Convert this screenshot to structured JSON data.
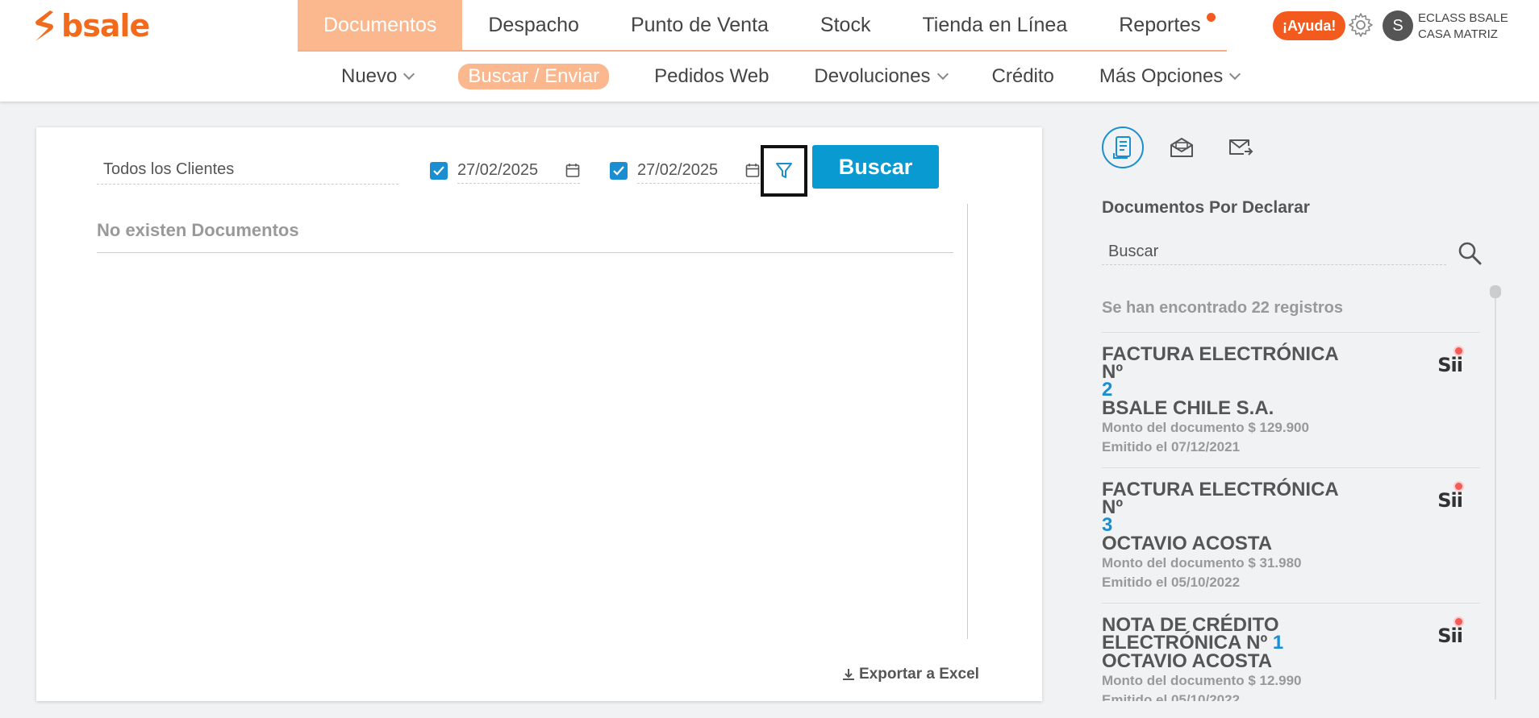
{
  "brand": {
    "name": "bsale",
    "color": "#f26b1d"
  },
  "main_nav": [
    {
      "label": "Documentos",
      "active": true
    },
    {
      "label": "Despacho"
    },
    {
      "label": "Punto de Venta"
    },
    {
      "label": "Stock"
    },
    {
      "label": "Tienda en Línea"
    },
    {
      "label": "Reportes",
      "notification": true
    }
  ],
  "header": {
    "help_label": "¡Ayuda!",
    "settings_icon": "gear-icon",
    "avatar_initial": "S",
    "company_line1": "ECLASS BSALE",
    "company_line2": "CASA MATRIZ"
  },
  "sub_nav": [
    {
      "label": "Nuevo",
      "dropdown": true
    },
    {
      "label": "Buscar / Enviar",
      "active": true
    },
    {
      "label": "Pedidos Web"
    },
    {
      "label": "Devoluciones",
      "dropdown": true
    },
    {
      "label": "Crédito"
    },
    {
      "label": "Más Opciones",
      "dropdown": true
    }
  ],
  "search_form": {
    "client_value": "Todos los Clientes",
    "date_from": "27/02/2025",
    "date_to": "27/02/2025",
    "date_from_checked": true,
    "date_to_checked": true,
    "filter_icon": "filter-icon",
    "search_label": "Buscar"
  },
  "results": {
    "empty_message": "No existen Documentos",
    "export_label": "Exportar a Excel"
  },
  "right_panel": {
    "tabs": [
      "receipt-icon",
      "mail-open-icon",
      "mail-send-icon"
    ],
    "title": "Documentos Por Declarar",
    "search_placeholder": "Buscar",
    "count_text": "Se han encontrado 22 registros",
    "documents": [
      {
        "title": "FACTURA ELECTRÓNICA Nº",
        "number": "2",
        "client": "BSALE CHILE S.A.",
        "amount": "Monto del documento $ 129.900",
        "issued": "Emitido el 07/12/2021",
        "badge": "Sii"
      },
      {
        "title": "FACTURA ELECTRÓNICA Nº",
        "number": "3",
        "client": "OCTAVIO ACOSTA",
        "amount": "Monto del documento $ 31.980",
        "issued": "Emitido el 05/10/2022",
        "badge": "Sii"
      },
      {
        "title": "NOTA DE CRÉDITO ELECTRÓNICA Nº",
        "number": "1",
        "client": "OCTAVIO ACOSTA",
        "amount": "Monto del documento $ 12.990",
        "issued": "Emitido el 05/10/2022",
        "badge": "Sii"
      }
    ]
  },
  "colors": {
    "accent": "#0a9ad2",
    "nav_active": "#fbb88e",
    "alert": "#f35b1e"
  }
}
